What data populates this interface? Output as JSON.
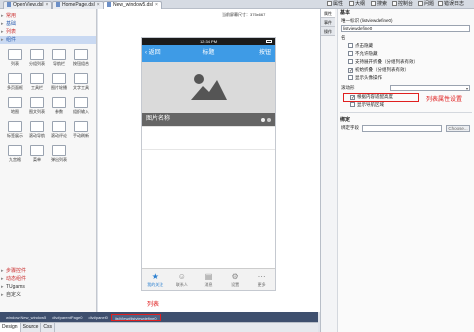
{
  "file_tabs": [
    {
      "label": "OpenView.dsl",
      "active": false
    },
    {
      "label": "HomePage.dsl",
      "active": false
    },
    {
      "label": "New_window5.dsl",
      "active": true
    }
  ],
  "right_tabs": [
    "属性",
    "大纲",
    "搜索",
    "控制台",
    "问题",
    "错误日志"
  ],
  "palette": {
    "top_categories": [
      {
        "label": "常用",
        "style": "red"
      },
      {
        "label": "基础",
        "style": "blue"
      },
      {
        "label": "列表",
        "style": "red"
      },
      {
        "label": "组件",
        "style": "selected"
      }
    ],
    "items": [
      "列表",
      "分组列表",
      "导航栏",
      "按钮组合",
      "多页面框",
      "工具栏",
      "图片轮播",
      "文字工具",
      "地图",
      "图文列表",
      "参数",
      "组织输入",
      "标签展示",
      "滚动导航",
      "滚动评论",
      "手动刷新",
      "九宫格",
      "菜单",
      "弹出列表"
    ],
    "bottom_categories": [
      "步骤控件",
      "动态组件",
      "TUgams",
      "自定义"
    ]
  },
  "canvas": {
    "size_label": "当前屏幕尺寸：375x667"
  },
  "phone": {
    "status_time": "12:34 PM",
    "nav_back": "返回",
    "nav_title": "标题",
    "nav_right": "按钮",
    "hero_caption": "图片名称",
    "tabs": [
      {
        "label": "我的关注",
        "icon": "★",
        "active": true
      },
      {
        "label": "联系人",
        "icon": "☺",
        "active": false
      },
      {
        "label": "消息",
        "icon": "▤",
        "active": false
      },
      {
        "label": "设置",
        "icon": "⚙",
        "active": false
      },
      {
        "label": "更多",
        "icon": "⋯",
        "active": false
      }
    ]
  },
  "annotations": {
    "list": "列表",
    "prop": "列表属性设置"
  },
  "breadcrumbs": [
    {
      "label": "window:New_window5",
      "highlight": false
    },
    {
      "label": "div#parentPage0",
      "highlight": false
    },
    {
      "label": "div#panel0",
      "highlight": false
    },
    {
      "label": "listView#listviewdefine0",
      "highlight": true
    }
  ],
  "bottom_tabs": [
    {
      "label": "Design",
      "active": true
    },
    {
      "label": "Source",
      "active": false
    },
    {
      "label": "Css",
      "active": false
    }
  ],
  "vtabs": [
    "属性",
    "事件",
    "操作"
  ],
  "props": {
    "section_basic": "基本",
    "id_label": "唯一标识 (listviewdefine0)",
    "id_input": "listviewdefine0",
    "name_label": "名",
    "checkboxes": [
      {
        "label": "点击隐藏",
        "checked": false
      },
      {
        "label": "不允许隐藏",
        "checked": false
      },
      {
        "label": "支持展开折叠（分组列表有效）",
        "checked": false
      },
      {
        "label": "初始折叠（分组列表有效）",
        "checked": true
      },
      {
        "label": "显示头像操作",
        "checked": false
      }
    ],
    "data_source_label": "滚动形",
    "checkboxes2": [
      {
        "label": "根据内容适配高度",
        "checked": true
      },
      {
        "label": "显示导航区域",
        "checked": false
      }
    ],
    "section_bind": "绑定",
    "bind_field_label": "绑定字段",
    "choose_button": "Choose..."
  },
  "colors": {
    "nav_blue": "#3e9be6",
    "annotation_red": "#e02020",
    "breadcrumb_bg": "#3e4f6e"
  }
}
